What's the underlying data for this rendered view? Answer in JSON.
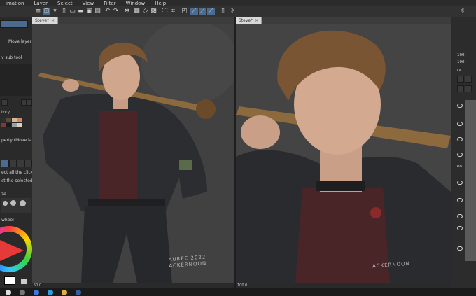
{
  "menu": {
    "items": [
      "imation",
      "Layer",
      "Select",
      "View",
      "Filter",
      "Window",
      "Help"
    ]
  },
  "left_panel": {
    "move_layer": "Move layer",
    "sub_tool": "v sub tool",
    "history_title": "tory",
    "property_title": "perty (Move layer)",
    "select_text_1": "ect all the clicked l",
    "select_text_2": "ct the selected lay",
    "brush_title": "ze",
    "color_title": "wheel",
    "color_swatches": [
      "#2e2e2e",
      "#5a4a3a",
      "#d6b89a",
      "#c98a6a",
      "#7a3b3b",
      "#1a1a1a",
      "#9aa0a8",
      "#e0d0b8"
    ]
  },
  "canvas_a": {
    "tab_label": "Steve*",
    "close": "×",
    "zoom": "50.0",
    "signature": "AUREE 2022 ACKERNOON"
  },
  "canvas_b": {
    "tab_label": "Steve*",
    "close": "×",
    "zoom": "100.0",
    "signature": "ACKERNOON"
  },
  "right_panel": {
    "val_1": "100",
    "val_2": "100",
    "val_3": "Le",
    "val_4": "no"
  },
  "colors": {
    "accent": "#4b6b8f",
    "canvas_bg": "#3c3c3c",
    "panel_bg": "#2a2a2a",
    "wheel_main": "#e63a3a"
  }
}
